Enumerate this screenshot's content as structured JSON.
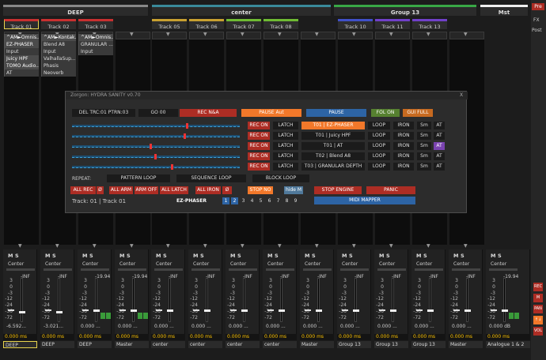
{
  "top_groups": [
    {
      "label": "DEEP",
      "color": "#3ba1d0"
    },
    {
      "label": "center",
      "color": "#3a8a9a"
    },
    {
      "label": "Group 13",
      "color": "#39a846"
    },
    {
      "label": "Mst",
      "color": "#eeeeee"
    }
  ],
  "tracks": [
    {
      "label": "Track 01",
      "color": "#c83030"
    },
    {
      "label": "Track 02",
      "color": "#c83030"
    },
    {
      "label": "Track 03",
      "color": "#c83030"
    },
    {
      "label": "Track 05",
      "color": "#c8a030"
    },
    {
      "label": "Track 06",
      "color": "#c8a030"
    },
    {
      "label": "Track 07",
      "color": "#6fbb33"
    },
    {
      "label": "Track 08",
      "color": "#6fbb33"
    },
    {
      "label": "Track 10",
      "color": "#4050c8"
    },
    {
      "label": "Track 11",
      "color": "#7040c8"
    },
    {
      "label": "Track 13",
      "color": "#7040c8"
    }
  ],
  "fx_chains": {
    "t01": [
      "^AM►Omnis...",
      "EZ-PHASER",
      "Input",
      "Juicy HPF",
      "TOMO Audio...",
      "AT"
    ],
    "t02": [
      "^AM►Kontak...",
      "Blend A8",
      "Input",
      "ValhallaSup...",
      "Phasis",
      "Neoverb"
    ],
    "t03": [
      "^AM►Omnis...",
      "GRANULAR ...",
      "Input"
    ]
  },
  "right_sidebar": {
    "pre": "Pre",
    "fx": "FX",
    "post": "Post"
  },
  "side_buttons": [
    {
      "label": "REC",
      "color": "#ad2d24"
    },
    {
      "label": "M",
      "color": "#ad2d24"
    },
    {
      "label": "PAN",
      "color": "#ad2d24"
    },
    {
      "label": "↑↓",
      "color": "#f2782a"
    },
    {
      "label": "VOL",
      "color": "#ad2d24"
    }
  ],
  "zorgon": {
    "title": "Zorgon: HYDRA SANITY v0.70",
    "close": "X",
    "topbar": {
      "del": "DEL TRC:01 PTRN:03",
      "go": "GO 00",
      "rec_na": "REC N&A",
      "pause_aut": "PAUSE Aut",
      "pause": "PAUSE",
      "fol_on": "FOL ON",
      "gui_full": "GUI FULL"
    },
    "rows": [
      {
        "level": 0.69,
        "rec": "REC ON",
        "latch": "LATCH",
        "name": "T01 | EZ-PHASER",
        "loop": "LOOP",
        "iron": "IRON",
        "sm": "Sm",
        "at": "AT",
        "name_active": true,
        "at_active": false
      },
      {
        "level": 0.68,
        "rec": "REC ON",
        "latch": "LATCH",
        "name": "T01 | Juicy HPF",
        "loop": "LOOP",
        "iron": "IRON",
        "sm": "Sm",
        "at": "AT",
        "name_active": false,
        "at_active": false
      },
      {
        "level": 0.47,
        "rec": "REC ON",
        "latch": "LATCH",
        "name": "T01 | AT",
        "loop": "LOOP",
        "iron": "IRON",
        "sm": "Sm",
        "at": "AT",
        "name_active": false,
        "at_active": true
      },
      {
        "level": 0.5,
        "rec": "REC ON",
        "latch": "LATCH",
        "name": "T02 | Blend A8",
        "loop": "LOOP",
        "iron": "IRON",
        "sm": "Sm",
        "at": "AT",
        "name_active": false,
        "at_active": false
      },
      {
        "level": 0.6,
        "rec": "REC ON",
        "latch": "LATCH",
        "name": "T03 | GRANULAR DEPTH",
        "loop": "LOOP",
        "iron": "IRON",
        "sm": "Sm",
        "at": "AT",
        "name_active": false,
        "at_active": false
      }
    ],
    "repeat_label": "REPEAT:",
    "pattern_loop": "PATTERN LOOP",
    "sequence_loop": "SEQUENCE LOOP",
    "block_loop": "BLOCK LOOP",
    "all_rec": "ALL REC",
    "all_rec_x": "Ø",
    "all_arm": "ALL ARM",
    "arm_off": "ARM OFF",
    "all_latch": "ALL LATCH",
    "all_iron": "ALL IRON",
    "all_iron_x": "Ø",
    "stop_no": "STOP NO",
    "hide_m": "hide M",
    "stop_engine": "STOP ENGINE",
    "panic": "PANIC",
    "midi_mapper": "MIDI MAPPER",
    "status": "Track: 01 | Track 01",
    "plugin_name": "EZ-PHASER",
    "pages": [
      "1",
      "2",
      "3",
      "4",
      "5",
      "6",
      "7",
      "8",
      "9"
    ],
    "active_pages": [
      "1",
      "2"
    ]
  },
  "mixer": {
    "scale": [
      "3",
      "0",
      "-3",
      "-12",
      "-24",
      "-36",
      "-72"
    ],
    "strips": [
      {
        "pan": "Center",
        "peak": "-INF",
        "vol": "-6.592...",
        "latency": "0.000 ms",
        "route": "DEEP"
      },
      {
        "pan": "Center",
        "peak": "-INF",
        "vol": "-3.021...",
        "latency": "0.000 ms",
        "route": "DEEP"
      },
      {
        "pan": "Center",
        "peak": "-19.94",
        "vol": "0.000 ...",
        "latency": "0.000 ms",
        "route": "DEEP"
      },
      {
        "pan": "Center",
        "peak": "-19.94",
        "vol": "0.000 ...",
        "latency": "0.000 ms",
        "route": "Master"
      },
      {
        "pan": "Center",
        "peak": "-INF",
        "vol": "0.000 ...",
        "latency": "0.000 ms",
        "route": "center"
      },
      {
        "pan": "Center",
        "peak": "-INF",
        "vol": "0.000 ...",
        "latency": "0.000 ms",
        "route": "center"
      },
      {
        "pan": "Center",
        "peak": "-INF",
        "vol": "0.000 ...",
        "latency": "0.000 ms",
        "route": "center"
      },
      {
        "pan": "Center",
        "peak": "-INF",
        "vol": "0.000 ...",
        "latency": "0.000 ms",
        "route": "center"
      },
      {
        "pan": "Center",
        "peak": "-INF",
        "vol": "0.000 ...",
        "latency": "0.000 ms",
        "route": "Master"
      },
      {
        "pan": "Center",
        "peak": "-INF",
        "vol": "0.000 ...",
        "latency": "0.000 ms",
        "route": "Group 13"
      },
      {
        "pan": "Center",
        "peak": "-INF",
        "vol": "0.000 ...",
        "latency": "0.000 ms",
        "route": "Group 13"
      },
      {
        "pan": "Center",
        "peak": "-INF",
        "vol": "0.000 ...",
        "latency": "0.000 ms",
        "route": "Group 13"
      },
      {
        "pan": "Center",
        "peak": "-INF",
        "vol": "0.000 ...",
        "latency": "0.000 ms",
        "route": "Master"
      },
      {
        "pan": "Center",
        "peak": "-19.94",
        "vol": "0.000 dB",
        "latency": "0.000 ms",
        "route": "Analogue 1 & 2"
      }
    ]
  }
}
